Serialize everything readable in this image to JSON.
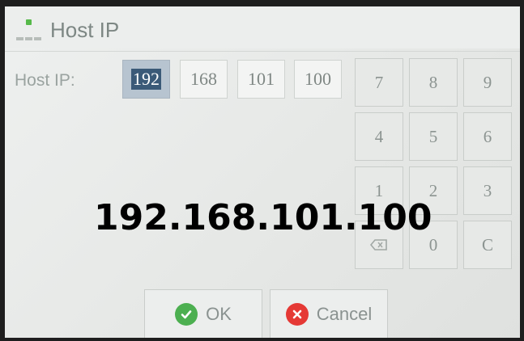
{
  "window": {
    "title": "Host IP"
  },
  "form": {
    "label": "Host IP:",
    "octets": [
      "192",
      "168",
      "101",
      "100"
    ]
  },
  "keypad": {
    "keys": [
      "7",
      "8",
      "9",
      "4",
      "5",
      "6",
      "1",
      "2",
      "3",
      "0",
      "C"
    ],
    "backspace_icon": "backspace-icon"
  },
  "overlay": {
    "ip_text": "192.168.101.100"
  },
  "buttons": {
    "ok_label": "OK",
    "cancel_label": "Cancel"
  },
  "colors": {
    "ok_icon": "#4caf50",
    "cancel_icon": "#e53935",
    "active_octet": "#3b5a78"
  }
}
